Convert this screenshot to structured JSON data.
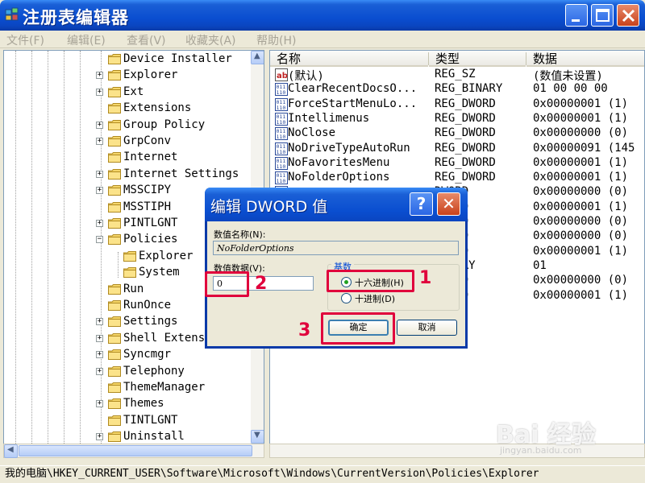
{
  "window": {
    "title": "注册表编辑器",
    "controls": [
      "minimize",
      "maximize",
      "close"
    ]
  },
  "menu": [
    "文件(F)",
    "编辑(E)",
    "查看(V)",
    "收藏夹(A)",
    "帮助(H)"
  ],
  "tree": {
    "items": [
      {
        "label": "Device Installer",
        "expander": "",
        "level": 0
      },
      {
        "label": "Explorer",
        "expander": "+",
        "level": 0
      },
      {
        "label": "Ext",
        "expander": "+",
        "level": 0
      },
      {
        "label": "Extensions",
        "expander": "",
        "level": 0
      },
      {
        "label": "Group Policy",
        "expander": "+",
        "level": 0
      },
      {
        "label": "GrpConv",
        "expander": "+",
        "level": 0
      },
      {
        "label": "Internet",
        "expander": "",
        "level": 0
      },
      {
        "label": "Internet Settings",
        "expander": "+",
        "level": 0
      },
      {
        "label": "MSSCIPY",
        "expander": "+",
        "level": 0
      },
      {
        "label": "MSSTIPH",
        "expander": "",
        "level": 0
      },
      {
        "label": "PINTLGNT",
        "expander": "+",
        "level": 0
      },
      {
        "label": "Policies",
        "expander": "−",
        "level": 0
      },
      {
        "label": "Explorer",
        "expander": "",
        "level": 1
      },
      {
        "label": "System",
        "expander": "",
        "level": 1
      },
      {
        "label": "Run",
        "expander": "",
        "level": 0
      },
      {
        "label": "RunOnce",
        "expander": "",
        "level": 0
      },
      {
        "label": "Settings",
        "expander": "+",
        "level": 0
      },
      {
        "label": "Shell Extensions",
        "expander": "+",
        "level": 0
      },
      {
        "label": "Syncmgr",
        "expander": "+",
        "level": 0
      },
      {
        "label": "Telephony",
        "expander": "+",
        "level": 0
      },
      {
        "label": "ThemeManager",
        "expander": "",
        "level": 0
      },
      {
        "label": "Themes",
        "expander": "+",
        "level": 0
      },
      {
        "label": "TINTLGNT",
        "expander": "",
        "level": 0
      },
      {
        "label": "Uninstall",
        "expander": "+",
        "level": 0
      }
    ]
  },
  "list": {
    "headers": {
      "name": "名称",
      "type": "类型",
      "data": "数据"
    },
    "rows": [
      {
        "icon": "string-value-icon",
        "name": "(默认)",
        "type": "REG_SZ",
        "data": "(数值未设置)"
      },
      {
        "icon": "binary-value-icon",
        "name": "ClearRecentDocsO...",
        "type": "REG_BINARY",
        "data": "01 00 00 00"
      },
      {
        "icon": "binary-value-icon",
        "name": "ForceStartMenuLo...",
        "type": "REG_DWORD",
        "data": "0x00000001 (1)"
      },
      {
        "icon": "binary-value-icon",
        "name": "Intellimenus",
        "type": "REG_DWORD",
        "data": "0x00000001 (1)"
      },
      {
        "icon": "binary-value-icon",
        "name": "NoClose",
        "type": "REG_DWORD",
        "data": "0x00000000 (0)"
      },
      {
        "icon": "binary-value-icon",
        "name": "NoDriveTypeAutoRun",
        "type": "REG_DWORD",
        "data": "0x00000091 (145"
      },
      {
        "icon": "binary-value-icon",
        "name": "NoFavoritesMenu",
        "type": "REG_DWORD",
        "data": "0x00000001 (1)"
      },
      {
        "icon": "binary-value-icon",
        "name": "NoFolderOptions",
        "type": "REG_DWORD",
        "data": "0x00000001 (1)"
      },
      {
        "icon": "binary-value-icon",
        "name": "",
        "type": "DWORD",
        "data": "0x00000000 (0)"
      },
      {
        "icon": "binary-value-icon",
        "name": "",
        "type": "DWORD",
        "data": "0x00000001 (1)"
      },
      {
        "icon": "binary-value-icon",
        "name": "",
        "type": "DWORD",
        "data": "0x00000000 (0)"
      },
      {
        "icon": "binary-value-icon",
        "name": "",
        "type": "DWORD",
        "data": "0x00000000 (0)"
      },
      {
        "icon": "binary-value-icon",
        "name": "",
        "type": "DWORD",
        "data": "0x00000001 (1)"
      },
      {
        "icon": "binary-value-icon",
        "name": "",
        "type": "BINARY",
        "data": "01"
      },
      {
        "icon": "binary-value-icon",
        "name": "",
        "type": "DWORD",
        "data": "0x00000000 (0)"
      },
      {
        "icon": "binary-value-icon",
        "name": "",
        "type": "DWORD",
        "data": "0x00000001 (1)"
      }
    ]
  },
  "status": "我的电脑\\HKEY_CURRENT_USER\\Software\\Microsoft\\Windows\\CurrentVersion\\Policies\\Explorer",
  "dialog": {
    "title": "编辑 DWORD 值",
    "help_label": "?",
    "close_label": "✕",
    "value_name_label": "数值名称(N):",
    "value_name": "NoFolderOptions",
    "value_data_label": "数值数据(V):",
    "value_data": "0",
    "base_label": "基数",
    "hex_label": "十六进制(H)",
    "dec_label": "十进制(D)",
    "hex_checked": true,
    "ok_label": "确定",
    "cancel_label": "取消"
  },
  "annotations": {
    "step1": "1",
    "step2": "2",
    "step3": "3"
  },
  "watermark": {
    "brand": "Bai 经验",
    "url": "jingyan.baidu.com"
  },
  "colors": {
    "titlebar": "#0a4ed0",
    "highlight": "#e0003c",
    "menu_text": "#a8a497"
  }
}
